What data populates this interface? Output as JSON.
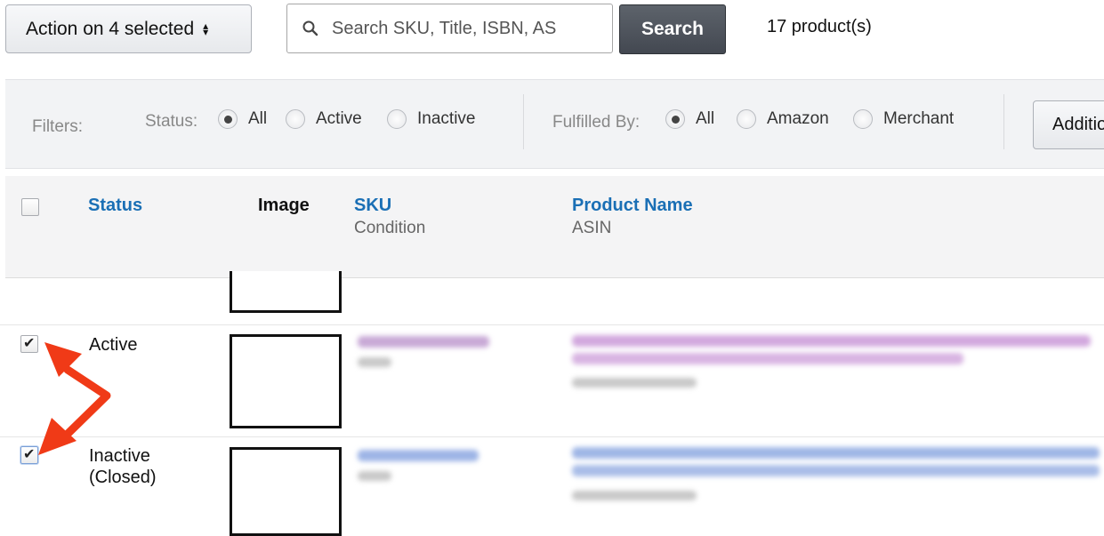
{
  "toolbar": {
    "action_label": "Action on 4 selected",
    "search_placeholder": "Search SKU, Title, ISBN, AS",
    "search_button": "Search",
    "product_count": "17 product(s)"
  },
  "filters": {
    "label": "Filters:",
    "status_label": "Status:",
    "status_options": [
      "All",
      "Active",
      "Inactive"
    ],
    "status_selected": "All",
    "fulfilled_label": "Fulfilled By:",
    "fulfilled_options": [
      "All",
      "Amazon",
      "Merchant"
    ],
    "fulfilled_selected": "All",
    "additional_button": "Additional"
  },
  "table": {
    "columns": {
      "status": "Status",
      "image": "Image",
      "sku": "SKU",
      "sku_sub": "Condition",
      "product_name": "Product Name",
      "product_name_sub": "ASIN"
    },
    "rows": [
      {
        "status": "Active",
        "checked": true
      },
      {
        "status_line1": "Inactive",
        "status_line2": "(Closed)",
        "checked": true
      }
    ]
  },
  "colors": {
    "link_blue": "#1a6fb5",
    "annotation_red": "#f03a17",
    "search_button_bg": "#4f545c"
  }
}
